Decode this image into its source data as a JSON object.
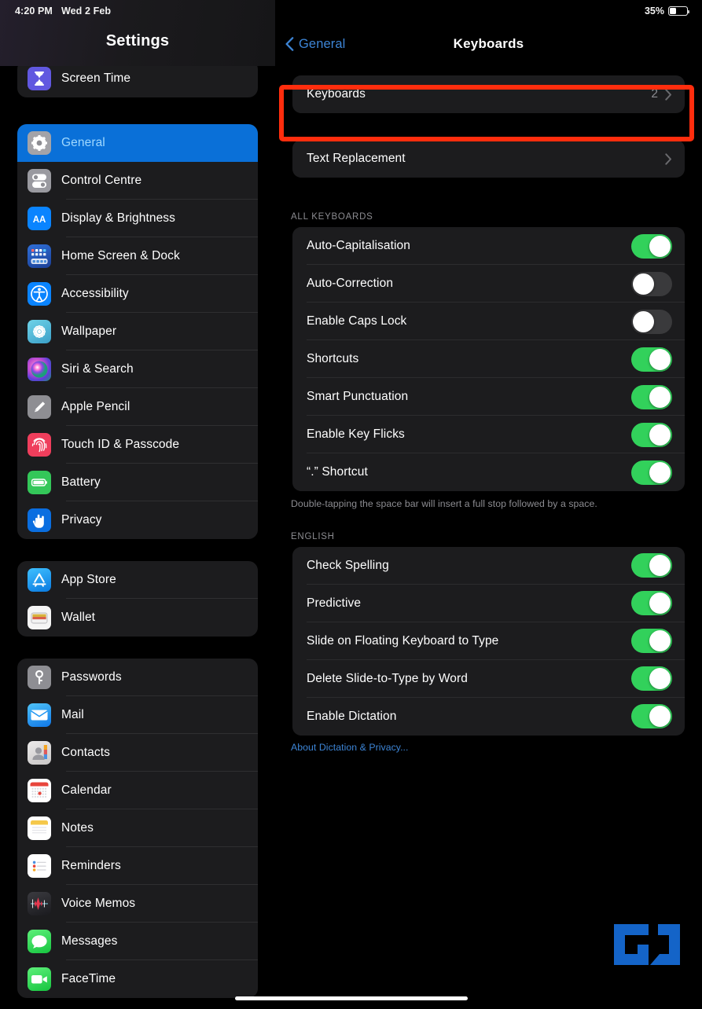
{
  "status": {
    "time": "4:20 PM",
    "date": "Wed 2 Feb",
    "battery_percent": "35%",
    "battery_level": 35
  },
  "sidebar": {
    "title": "Settings",
    "groups": [
      {
        "name": "screen-time-group",
        "items": [
          {
            "label": "Screen Time",
            "icon": "hourglass-icon",
            "selected": false
          }
        ]
      },
      {
        "name": "system-group",
        "items": [
          {
            "label": "General",
            "icon": "gear-icon",
            "selected": true
          },
          {
            "label": "Control Centre",
            "icon": "sliders-icon",
            "selected": false
          },
          {
            "label": "Display & Brightness",
            "icon": "aa-icon",
            "selected": false
          },
          {
            "label": "Home Screen & Dock",
            "icon": "grid-icon",
            "selected": false
          },
          {
            "label": "Accessibility",
            "icon": "accessibility-icon",
            "selected": false
          },
          {
            "label": "Wallpaper",
            "icon": "flower-icon",
            "selected": false
          },
          {
            "label": "Siri & Search",
            "icon": "siri-icon",
            "selected": false
          },
          {
            "label": "Apple Pencil",
            "icon": "pencil-icon",
            "selected": false
          },
          {
            "label": "Touch ID & Passcode",
            "icon": "fingerprint-icon",
            "selected": false
          },
          {
            "label": "Battery",
            "icon": "battery-icon",
            "selected": false
          },
          {
            "label": "Privacy",
            "icon": "hand-icon",
            "selected": false
          }
        ]
      },
      {
        "name": "store-group",
        "items": [
          {
            "label": "App Store",
            "icon": "app-store-icon",
            "selected": false
          },
          {
            "label": "Wallet",
            "icon": "wallet-icon",
            "selected": false
          }
        ]
      },
      {
        "name": "apps-group",
        "items": [
          {
            "label": "Passwords",
            "icon": "key-icon",
            "selected": false
          },
          {
            "label": "Mail",
            "icon": "mail-icon",
            "selected": false
          },
          {
            "label": "Contacts",
            "icon": "contacts-icon",
            "selected": false
          },
          {
            "label": "Calendar",
            "icon": "calendar-icon",
            "selected": false
          },
          {
            "label": "Notes",
            "icon": "notes-icon",
            "selected": false
          },
          {
            "label": "Reminders",
            "icon": "reminders-icon",
            "selected": false
          },
          {
            "label": "Voice Memos",
            "icon": "waveform-icon",
            "selected": false
          },
          {
            "label": "Messages",
            "icon": "messages-icon",
            "selected": false
          },
          {
            "label": "FaceTime",
            "icon": "facetime-icon",
            "selected": false
          }
        ]
      }
    ]
  },
  "detail": {
    "back_label": "General",
    "title": "Keyboards",
    "keyboards_row": {
      "label": "Keyboards",
      "value": "2"
    },
    "text_replacement_row": {
      "label": "Text Replacement"
    },
    "all_keyboards": {
      "header": "ALL KEYBOARDS",
      "rows": [
        {
          "label": "Auto-Capitalisation",
          "on": true
        },
        {
          "label": "Auto-Correction",
          "on": false
        },
        {
          "label": "Enable Caps Lock",
          "on": false
        },
        {
          "label": "Shortcuts",
          "on": true
        },
        {
          "label": "Smart Punctuation",
          "on": true
        },
        {
          "label": "Enable Key Flicks",
          "on": true
        },
        {
          "label": "“.” Shortcut",
          "on": true
        }
      ],
      "footnote": "Double-tapping the space bar will insert a full stop followed by a space."
    },
    "english": {
      "header": "ENGLISH",
      "rows": [
        {
          "label": "Check Spelling",
          "on": true
        },
        {
          "label": "Predictive",
          "on": true
        },
        {
          "label": "Slide on Floating Keyboard to Type",
          "on": true
        },
        {
          "label": "Delete Slide-to-Type by Word",
          "on": true
        },
        {
          "label": "Enable Dictation",
          "on": true
        }
      ],
      "footer_link": "About Dictation & Privacy..."
    }
  },
  "annotation": {
    "highlight_color": "#ff2d0d",
    "target": "keyboards-row"
  },
  "watermark": {
    "text": "GJ",
    "color": "#1464c8"
  }
}
